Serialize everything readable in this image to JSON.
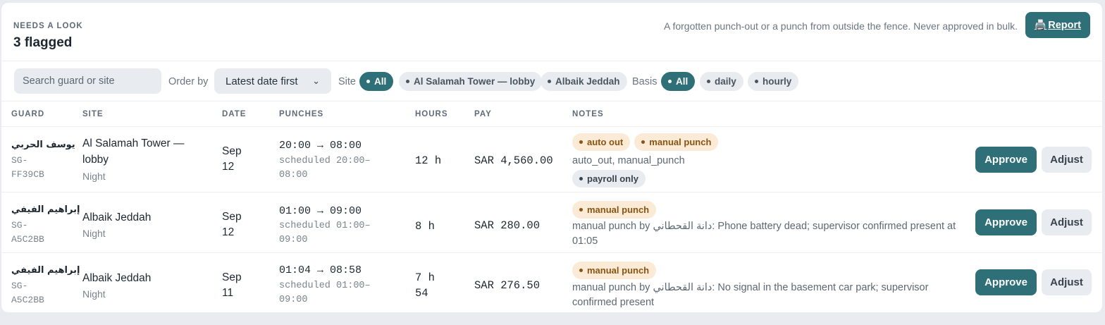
{
  "header": {
    "eyebrow": "NEEDS A LOOK",
    "count_title": "3 flagged",
    "note": "A forgotten punch-out or a punch from outside the fence. Never approved in bulk.",
    "report_icon": "printer-icon",
    "report_label": "Report"
  },
  "toolbar": {
    "search_placeholder": "Search guard or site",
    "order_label": "Order by",
    "order_value": "Latest date first",
    "site_label": "Site",
    "site_options": [
      "All",
      "Al Salamah Tower — lobby",
      "Albaik Jeddah"
    ],
    "site_selected": "All",
    "basis_label": "Basis",
    "basis_options": [
      "All",
      "daily",
      "hourly"
    ],
    "basis_selected": "All"
  },
  "columns": [
    "GUARD",
    "SITE",
    "DATE",
    "PUNCHES",
    "HOURS",
    "PAY",
    "NOTES"
  ],
  "rows": [
    {
      "guard_name": "يوسف الحربي",
      "guard_id": "SG-FF39CB",
      "site": "Al Salamah Tower — lobby",
      "shift": "Night",
      "date": "Sep 12",
      "punches": "20:00 → 08:00",
      "scheduled": "scheduled 20:00–08:00",
      "hours": "12 h",
      "pay": "SAR 4,560.00",
      "tags": [
        "auto out",
        "manual punch"
      ],
      "note": "auto_out, manual_punch",
      "extra_tag": "payroll only",
      "approve": "Approve",
      "adjust": "Adjust"
    },
    {
      "guard_name": "إبراهيم الفيفي",
      "guard_id": "SG-A5C2BB",
      "site": "Albaik Jeddah",
      "shift": "Night",
      "date": "Sep 12",
      "punches": "01:00 → 09:00",
      "scheduled": "scheduled 01:00–09:00",
      "hours": "8 h",
      "pay": "SAR 280.00",
      "tags": [
        "manual punch"
      ],
      "note": "manual punch by دانة القحطاني: Phone battery dead; supervisor confirmed present at 01:05",
      "approve": "Approve",
      "adjust": "Adjust"
    },
    {
      "guard_name": "إبراهيم الفيفي",
      "guard_id": "SG-A5C2BB",
      "site": "Albaik Jeddah",
      "shift": "Night",
      "date": "Sep 11",
      "punches": "01:04 → 08:58",
      "scheduled": "scheduled 01:00–09:00",
      "hours": "7 h 54",
      "pay": "SAR 276.50",
      "tags": [
        "manual punch"
      ],
      "note": "manual punch by دانة القحطاني: No signal in the basement car park; supervisor confirmed present",
      "approve": "Approve",
      "adjust": "Adjust"
    }
  ],
  "colors": {
    "accent": "#2e6f78",
    "tag_warn_bg": "#fbead5",
    "tag_warn_fg": "#8a5413",
    "neutral_bg": "#e8ecf0"
  }
}
